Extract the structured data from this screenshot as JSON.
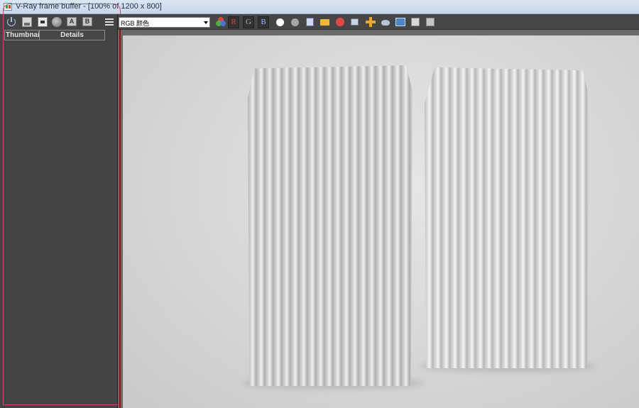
{
  "window": {
    "title": "V-Ray frame buffer - [100% of 1200 x 800]"
  },
  "history_panel": {
    "toolbar": {
      "icons": [
        "power-icon",
        "save-icon",
        "load-icon",
        "record-icon",
        "a-button",
        "b-button",
        "menu-icon"
      ],
      "a_label": "A",
      "b_label": "B"
    },
    "columns": [
      "Thumbnail",
      "Details"
    ]
  },
  "main_toolbar": {
    "channel_select": "RGB 颜色",
    "channel_buttons": [
      "R",
      "G",
      "B"
    ],
    "icons": [
      "color-correction-icon",
      "white-display-icon",
      "mono-display-icon",
      "save-image-icon",
      "open-image-icon",
      "stop-render-icon",
      "region-render-icon",
      "track-mouse-icon",
      "render-last-icon",
      "lens-effects-icon",
      "compare-icon",
      "stereo-icon"
    ]
  },
  "colors": {
    "panel_bg": "#444444",
    "toolbar_bg": "#464646",
    "red_channel": "#e23b3b",
    "annotation": "#d04c6c"
  }
}
